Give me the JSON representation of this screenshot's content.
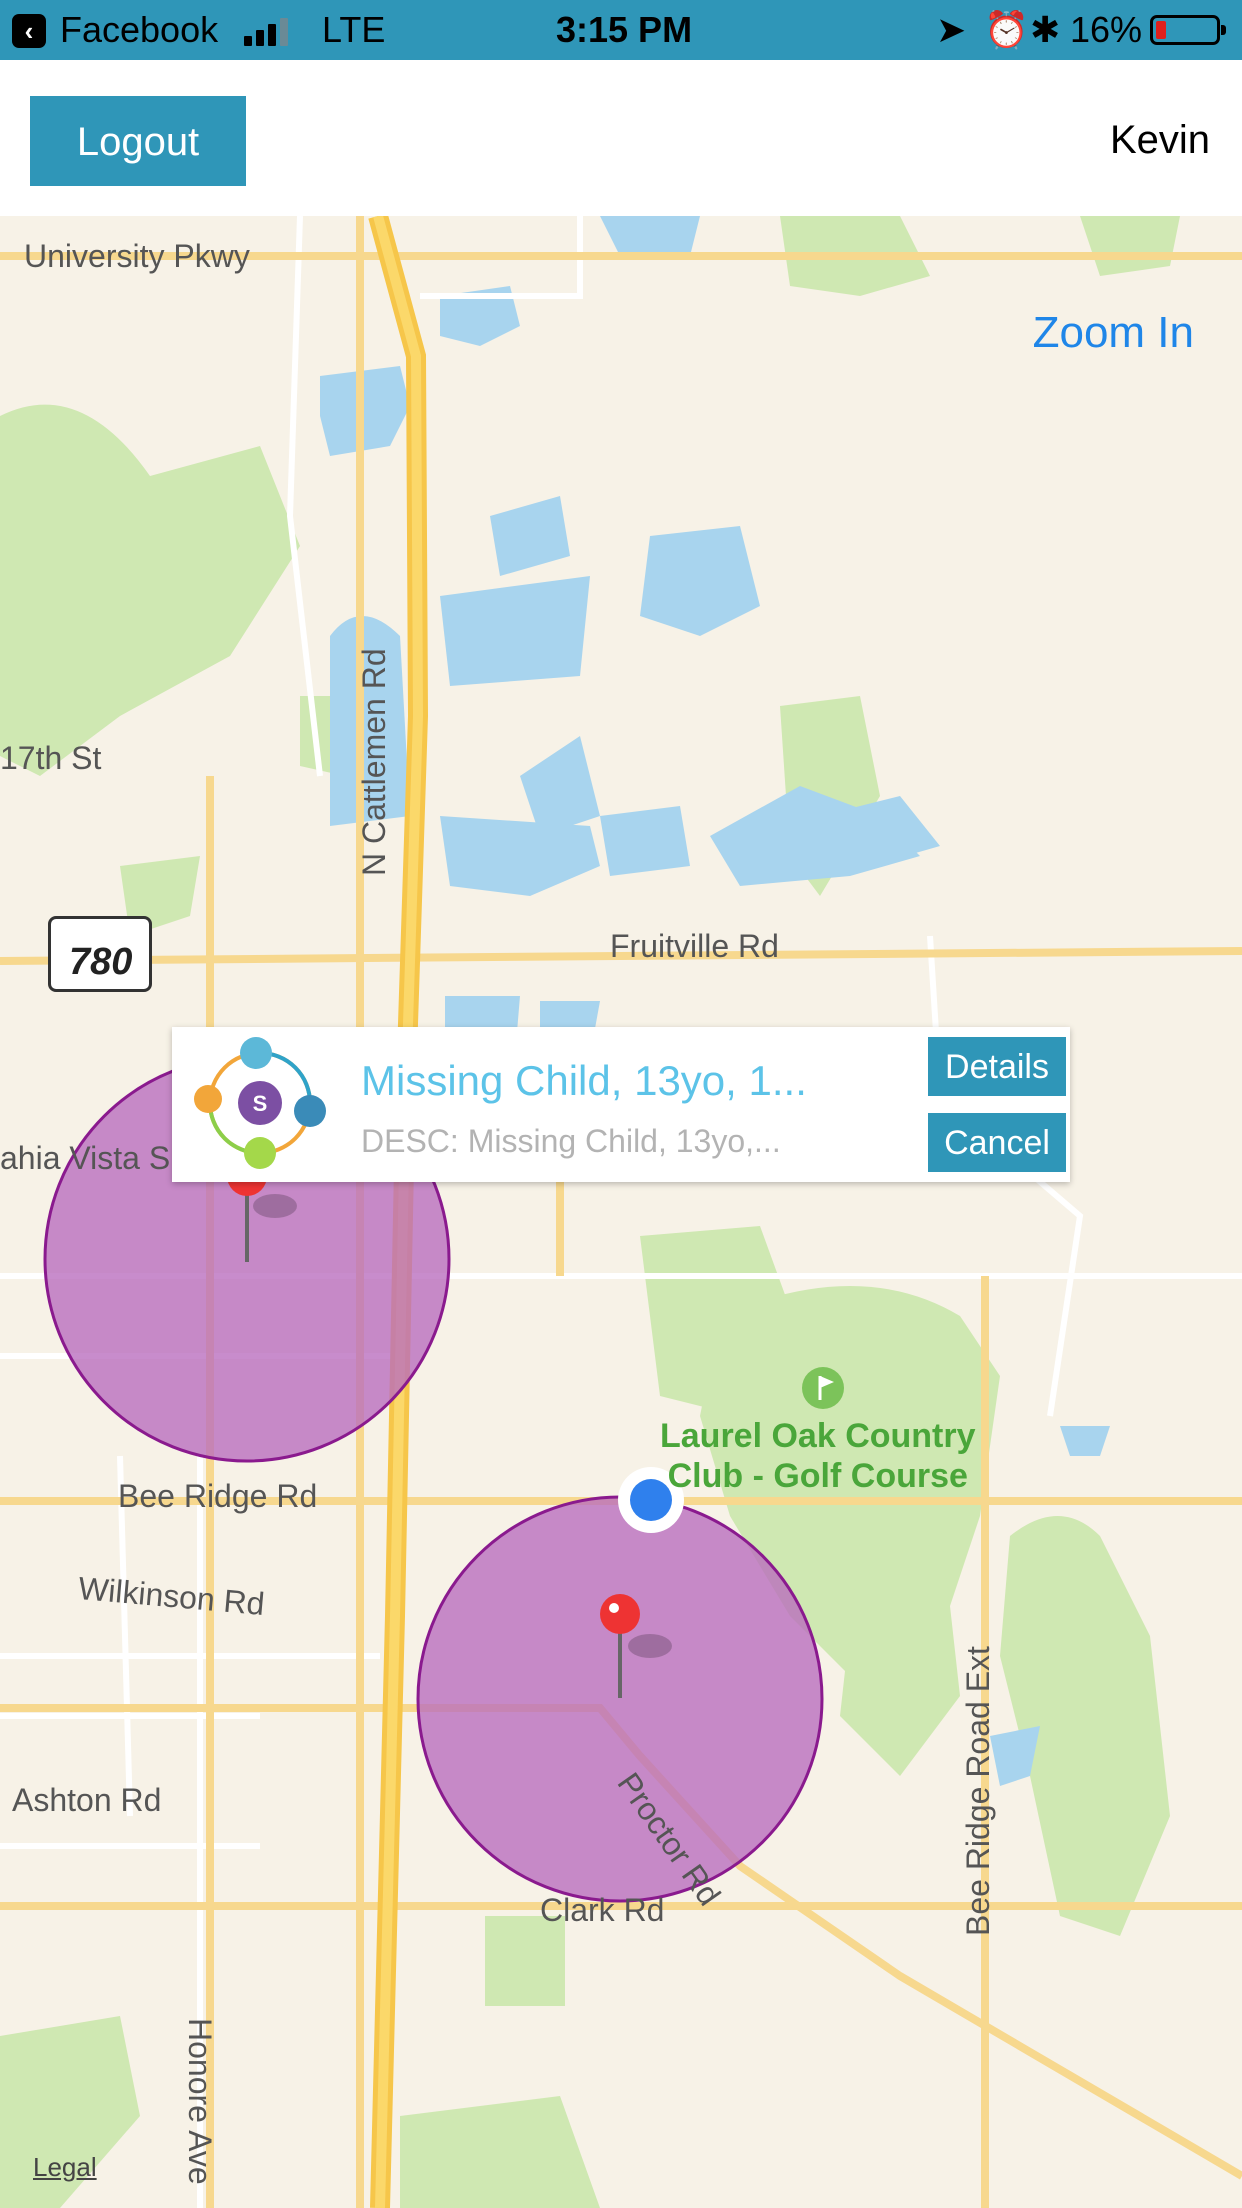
{
  "status_bar": {
    "back_app": "Facebook",
    "network": "LTE",
    "time": "3:15 PM",
    "battery": "16%"
  },
  "header": {
    "logout_label": "Logout",
    "user_name": "Kevin"
  },
  "map": {
    "zoom_in_label": "Zoom In",
    "legal_label": "Legal",
    "road_labels": {
      "university": "University Pkwy",
      "cattlemen": "N Cattlemen Rd",
      "seventeenth": "17th St",
      "fruitville": "Fruitville Rd",
      "bahia": "ahia Vista S",
      "bee_ridge": "Bee Ridge Rd",
      "wilkinson": "Wilkinson Rd",
      "ashton": "Ashton Rd",
      "clark": "Clark Rd",
      "proctor": "Proctor Rd",
      "bee_ridge_ext": "Bee Ridge Road Ext",
      "honore": "Honore Ave"
    },
    "route_shield": "780",
    "poi": {
      "line1": "Laurel Oak Country",
      "line2": "Club - Golf Course"
    }
  },
  "callout": {
    "title": "Missing Child, 13yo, 1...",
    "description": "DESC: Missing Child, 13yo,...",
    "details_label": "Details",
    "cancel_label": "Cancel"
  },
  "colors": {
    "accent": "#2f96b8",
    "link": "#1f86e8",
    "radius_fill": "#b96bbe",
    "radius_stroke": "#8a1a8e",
    "pin": "#ee3333",
    "user_location": "#2f80ed"
  }
}
